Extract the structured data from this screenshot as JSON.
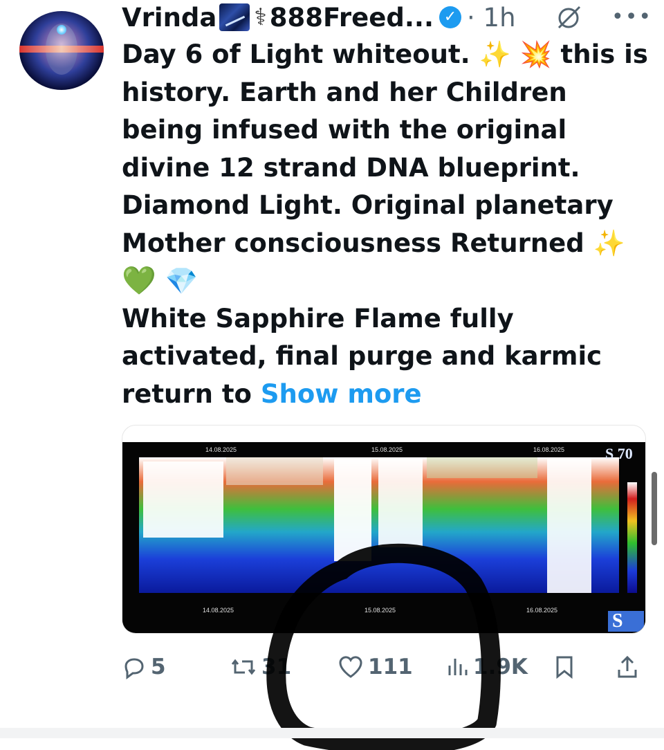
{
  "post": {
    "display_name": "Vrinda",
    "name_symbol": "⚕",
    "name_rest": "888Freed...",
    "time": "· 1h",
    "icons": {
      "verified": "verified-badge-icon",
      "grok": "grok-icon",
      "more": "more-icon"
    }
  },
  "tweet": {
    "line1": "Day 6 of Light whiteout.",
    "line1_end": "this is",
    "line2": "history. Earth and her Children",
    "line3": "being infused with the original",
    "line4": "divine 12 strand DNA blueprint.",
    "line5": "Diamond Light. Original planetary",
    "line6": "Mother consciousness Returned",
    "line8": "White Sapphire Flame fully",
    "line9": "activated, final purge and karmic",
    "line10": "return to",
    "show_more": "Show more",
    "emojis": {
      "sparkles": "✨",
      "collision": "💥",
      "green_heart": "💚",
      "gem": "💎"
    }
  },
  "media": {
    "date_top": [
      "14.08.2025",
      "15.08.2025",
      "16.08.2025"
    ],
    "date_bottom": [
      "14.08.2025",
      "15.08.2025",
      "16.08.2025"
    ],
    "badge": "S 70",
    "corner_letter": "S",
    "colors": {
      "white": "#ffffff",
      "red": "#d23a1c",
      "green": "#2fae3a",
      "blue": "#1b2fd6"
    }
  },
  "actions": {
    "replies": "5",
    "reposts": "31",
    "likes": "111",
    "views": "1.9K",
    "icons": [
      "reply-icon",
      "repost-icon",
      "like-icon",
      "views-icon",
      "bookmark-icon",
      "share-icon"
    ]
  }
}
